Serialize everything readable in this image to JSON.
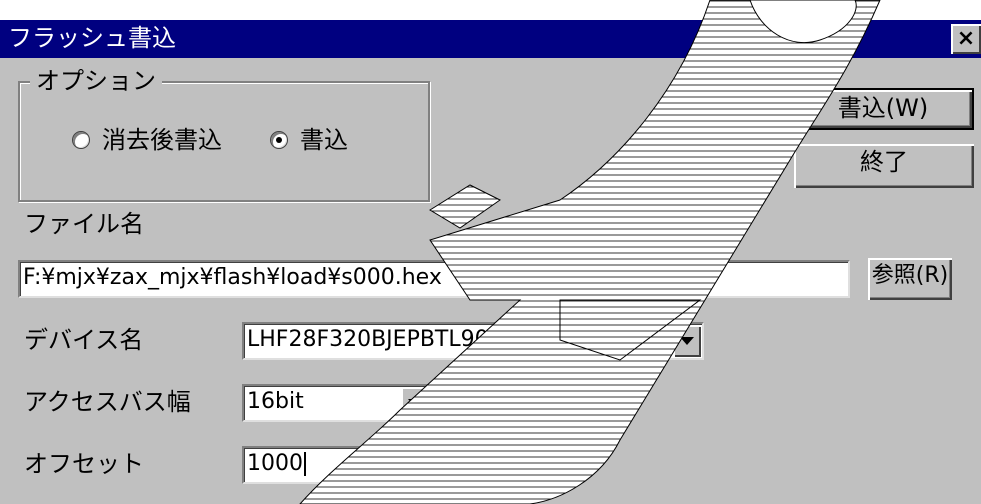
{
  "window": {
    "title": "フラッシュ書込",
    "close_label": "×"
  },
  "options_group": {
    "legend": "オプション",
    "radio_erase_write": {
      "label": "消去後書込",
      "checked": false
    },
    "radio_write": {
      "label": "書込",
      "checked": true
    }
  },
  "buttons": {
    "write_label": "書込(W)",
    "exit_label": "終了",
    "browse_label": "参照(R)"
  },
  "file": {
    "label": "ファイル名",
    "value": "F:¥mjx¥zax_mjx¥flash¥load¥s000.hex"
  },
  "device": {
    "label": "デバイス名",
    "value": "LHF28F320BJEPBTL90"
  },
  "bus_width": {
    "label": "アクセスバス幅",
    "value": "16bit"
  },
  "offset": {
    "label": "オフセット",
    "value": "1000"
  },
  "icons": {
    "combo_arrow": "triangle-down-icon",
    "close": "close-icon"
  }
}
